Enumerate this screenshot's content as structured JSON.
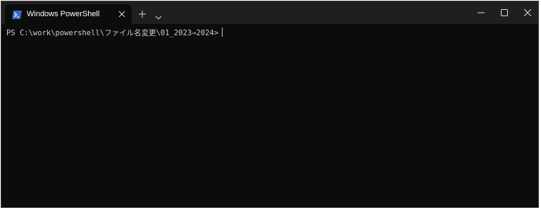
{
  "window": {
    "tab": {
      "title": "Windows PowerShell",
      "icon": "powershell-icon"
    },
    "titlebar_buttons": [
      "new-tab-icon",
      "dropdown-chevron-icon",
      "minimize-icon",
      "maximize-icon",
      "close-icon"
    ]
  },
  "terminal": {
    "prompt": "PS C:\\work\\powershell\\ファイル名変更\\01_2023→2024>"
  },
  "colors": {
    "background": "#0c0c0c",
    "titlebar": "#1f1f1f",
    "text": "#cccccc",
    "powershell_icon": "#3c68c4"
  }
}
